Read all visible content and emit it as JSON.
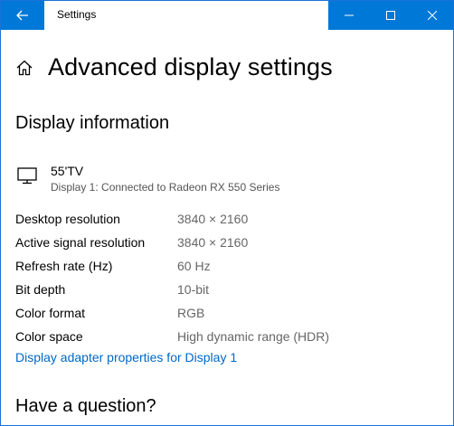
{
  "window": {
    "title": "Settings"
  },
  "page": {
    "title": "Advanced display settings"
  },
  "display_info": {
    "heading": "Display information",
    "monitor_name": "55'TV",
    "monitor_desc": "Display 1: Connected to Radeon RX 550 Series",
    "rows": [
      {
        "label": "Desktop resolution",
        "value": "3840 × 2160"
      },
      {
        "label": "Active signal resolution",
        "value": "3840 × 2160"
      },
      {
        "label": "Refresh rate (Hz)",
        "value": "60 Hz"
      },
      {
        "label": "Bit depth",
        "value": "10-bit"
      },
      {
        "label": "Color format",
        "value": "RGB"
      },
      {
        "label": "Color space",
        "value": "High dynamic range (HDR)"
      }
    ],
    "adapter_link": "Display adapter properties for Display 1"
  },
  "help": {
    "heading": "Have a question?"
  },
  "colors": {
    "accent": "#0078d7",
    "link": "#0068c9"
  }
}
